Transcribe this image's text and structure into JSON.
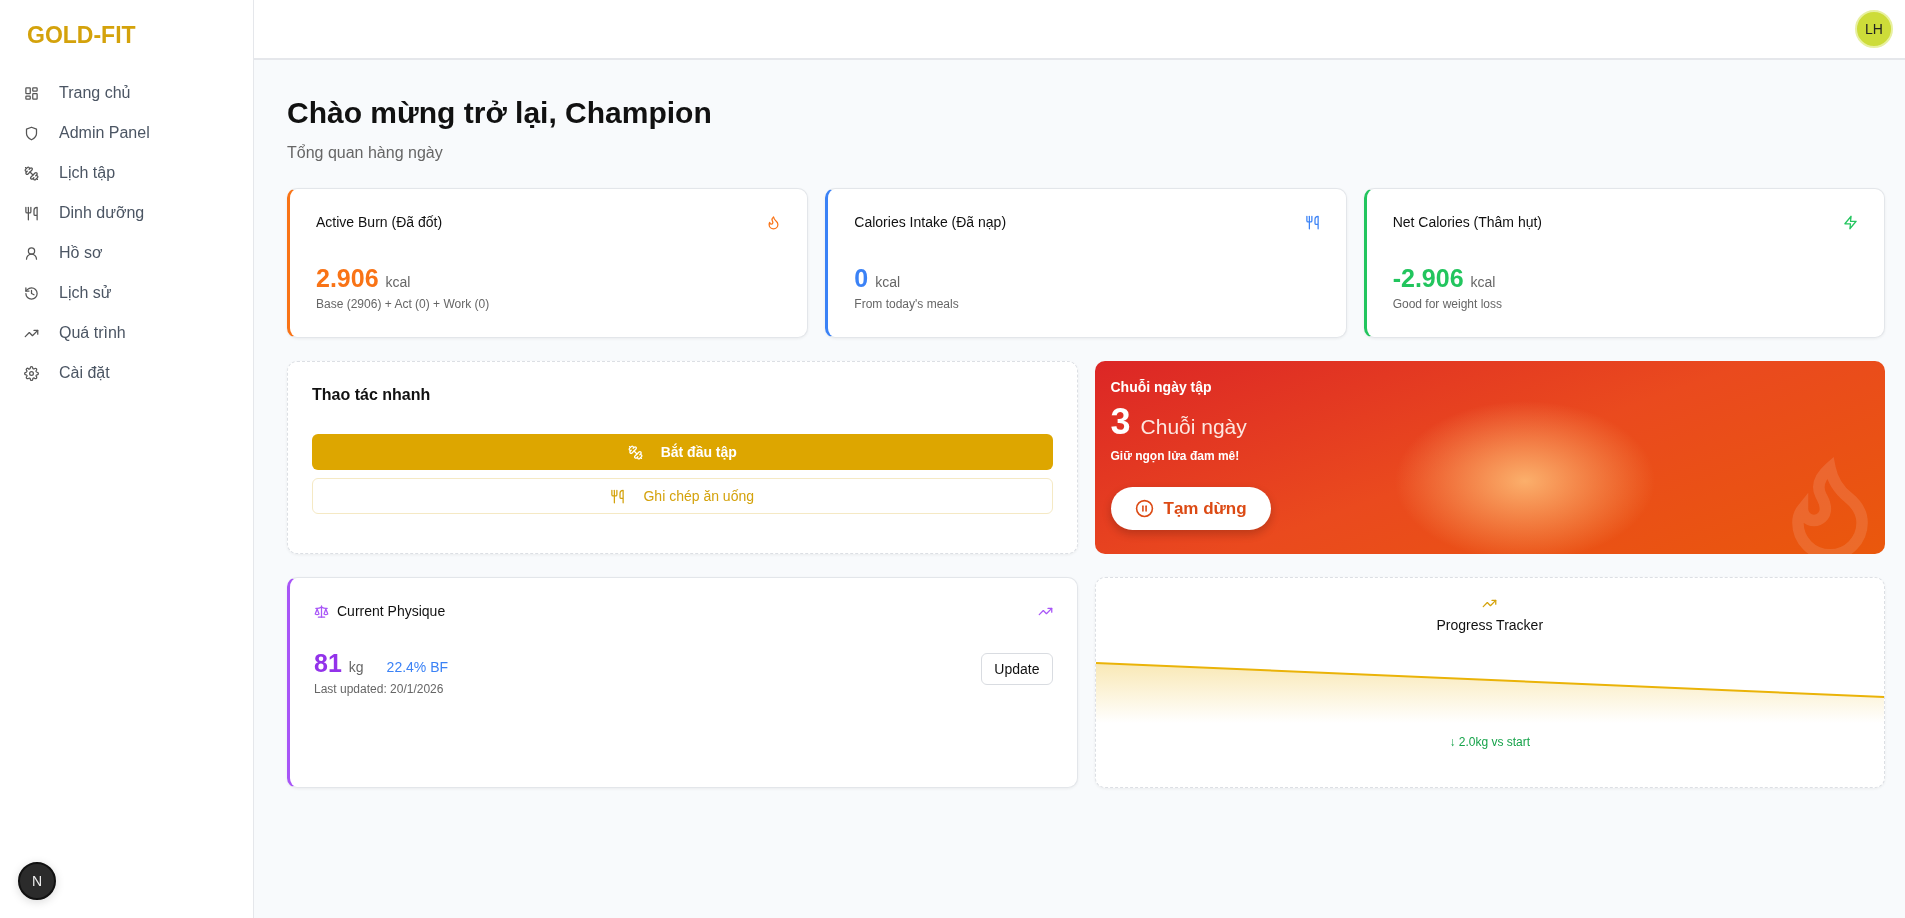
{
  "sidebar": {
    "logo": "GOLD-FIT",
    "items": [
      {
        "label": "Trang chủ",
        "kind": "grid"
      },
      {
        "label": "Admin Panel",
        "kind": "shield"
      },
      {
        "label": "Lịch tập",
        "kind": "dumbbell"
      },
      {
        "label": "Dinh dưỡng",
        "kind": "utensils"
      },
      {
        "label": "Hồ sơ",
        "kind": "user"
      },
      {
        "label": "Lịch sử",
        "kind": "history"
      },
      {
        "label": "Quá trình",
        "kind": "trend"
      },
      {
        "label": "Cài đặt",
        "kind": "gear"
      }
    ],
    "dev_badge": "N"
  },
  "header": {
    "avatar": "LH"
  },
  "page": {
    "title": "Chào mừng trở lại, Champion",
    "subtitle": "Tổng quan hàng ngày"
  },
  "stats": [
    {
      "title": "Active Burn (Đã đốt)",
      "kind": "flame",
      "color": "#f97316",
      "value": "2.906",
      "unit": "kcal",
      "note": "Base (2906) + Act (0) + Work (0)"
    },
    {
      "title": "Calories Intake (Đã nạp)",
      "kind": "utensils",
      "color": "#3b82f6",
      "value": "0",
      "unit": "kcal",
      "note": "From today's meals"
    },
    {
      "title": "Net Calories (Thâm hụt)",
      "kind": "zap",
      "color": "#22c55e",
      "value": "-2.906",
      "unit": "kcal",
      "note": "Good for weight loss"
    }
  ],
  "quick_actions": {
    "title": "Thao tác nhanh",
    "buttons": [
      {
        "label": "Bắt đầu tập",
        "kind": "primary"
      },
      {
        "label": "Ghi chép ăn uống",
        "kind": "outline"
      }
    ]
  },
  "streak": {
    "title": "Chuỗi ngày tập",
    "count": "3",
    "unit": "Chuỗi ngày",
    "message": "Giữ ngọn lửa đam mê!",
    "button": "Tạm dừng"
  },
  "physique": {
    "title": "Current Physique",
    "weight": "81",
    "unit": "kg",
    "body_fat": "22.4% BF",
    "updated": "Last updated: 20/1/2026",
    "button": "Update"
  },
  "progress": {
    "title": "Progress Tracker",
    "change": "↓ 2.0kg vs start"
  }
}
